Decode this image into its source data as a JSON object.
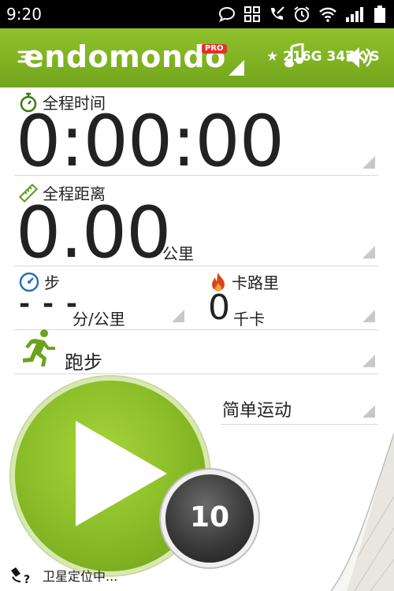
{
  "status_bar": {
    "time": "9:20"
  },
  "header": {
    "brand": "endomondo",
    "badge": "PRO",
    "status_text": "★ 216G 347K/S"
  },
  "duration": {
    "label": "全程时间",
    "value": "0:00:00"
  },
  "distance": {
    "label": "全程距离",
    "value": "0.00",
    "unit": "公里"
  },
  "pace": {
    "label": "步",
    "value": "- - -",
    "unit": "分/公里"
  },
  "calories": {
    "label": "卡路里",
    "value": "0",
    "unit": "千卡"
  },
  "sport": {
    "label": "跑步"
  },
  "workout": {
    "label": "简单运动"
  },
  "countdown": {
    "value": "10"
  },
  "gps": {
    "status": "卫星定位中..."
  },
  "colors": {
    "brand_green": "#80b225",
    "accent_red": "#e2322a"
  }
}
